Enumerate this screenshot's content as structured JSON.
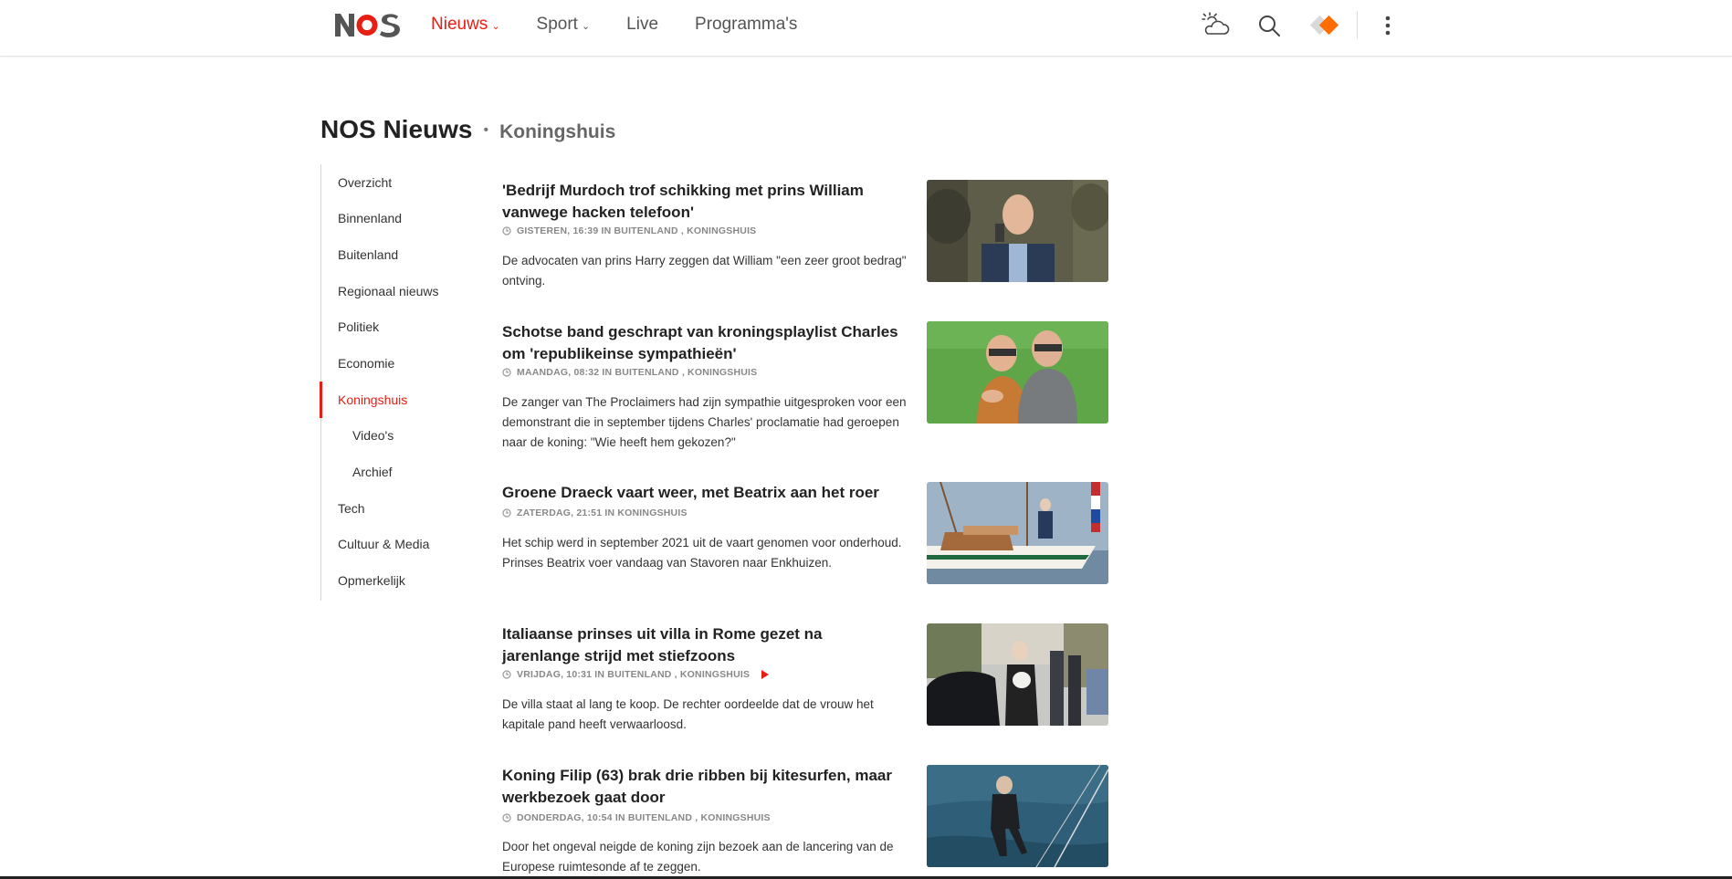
{
  "header": {
    "logo_text": "NOS",
    "nav": [
      {
        "label": "Nieuws",
        "active": true,
        "has_dropdown": true
      },
      {
        "label": "Sport",
        "active": false,
        "has_dropdown": true
      },
      {
        "label": "Live",
        "active": false,
        "has_dropdown": false
      },
      {
        "label": "Programma's",
        "active": false,
        "has_dropdown": false
      }
    ],
    "icons": [
      "weather-icon",
      "search-icon",
      "npo-start-icon",
      "more-icon"
    ],
    "npo_badge": "START"
  },
  "page": {
    "title": "NOS Nieuws",
    "subtitle": "Koningshuis"
  },
  "sidebar": {
    "items": [
      {
        "label": "Overzicht"
      },
      {
        "label": "Binnenland"
      },
      {
        "label": "Buitenland"
      },
      {
        "label": "Regionaal nieuws"
      },
      {
        "label": "Politiek"
      },
      {
        "label": "Economie"
      },
      {
        "label": "Koningshuis",
        "active": true
      },
      {
        "label": "Video's",
        "sub": true
      },
      {
        "label": "Archief",
        "sub": true
      },
      {
        "label": "Tech"
      },
      {
        "label": "Cultuur & Media"
      },
      {
        "label": "Opmerkelijk"
      }
    ]
  },
  "articles": [
    {
      "title": "'Bedrijf Murdoch trof schikking met prins William vanwege hacken telefoon'",
      "meta": "GISTEREN, 16:39 IN BUITENLAND , KONINGSHUIS",
      "summary": "De advocaten van prins Harry zeggen dat William \"een zeer groot bedrag\" ontving.",
      "has_video": false
    },
    {
      "title": "Schotse band geschrapt van kroningsplaylist Charles om 'republikeinse sympathieën'",
      "meta": "MAANDAG, 08:32 IN BUITENLAND , KONINGSHUIS",
      "summary": "De zanger van The Proclaimers had zijn sympathie uitgesproken voor een demonstrant die in september tijdens Charles' proclamatie had geroepen naar de koning: \"Wie heeft hem gekozen?\"",
      "has_video": false
    },
    {
      "title": "Groene Draeck vaart weer, met Beatrix aan het roer",
      "meta": "ZATERDAG, 21:51 IN KONINGSHUIS",
      "summary": "Het schip werd in september 2021 uit de vaart genomen voor onderhoud. Prinses Beatrix voer vandaag van Stavoren naar Enkhuizen.",
      "has_video": false
    },
    {
      "title": "Italiaanse prinses uit villa in Rome gezet na jarenlange strijd met stiefzoons",
      "meta": "VRIJDAG, 10:31 IN BUITENLAND , KONINGSHUIS",
      "summary": "De villa staat al lang te koop. De rechter oordeelde dat de vrouw het kapitale pand heeft verwaarloosd.",
      "has_video": true
    },
    {
      "title": "Koning Filip (63) brak drie ribben bij kitesurfen, maar werkbezoek gaat door",
      "meta": "DONDERDAG, 10:54 IN BUITENLAND , KONINGSHUIS",
      "summary": "Door het ongeval neigde de koning zijn bezoek aan de lancering van de Europese ruimtesonde af te zeggen.",
      "has_video": false
    }
  ],
  "colors": {
    "accent": "#e61e14",
    "npo_orange": "#ff6d00",
    "text": "#222222",
    "meta": "#888888"
  }
}
